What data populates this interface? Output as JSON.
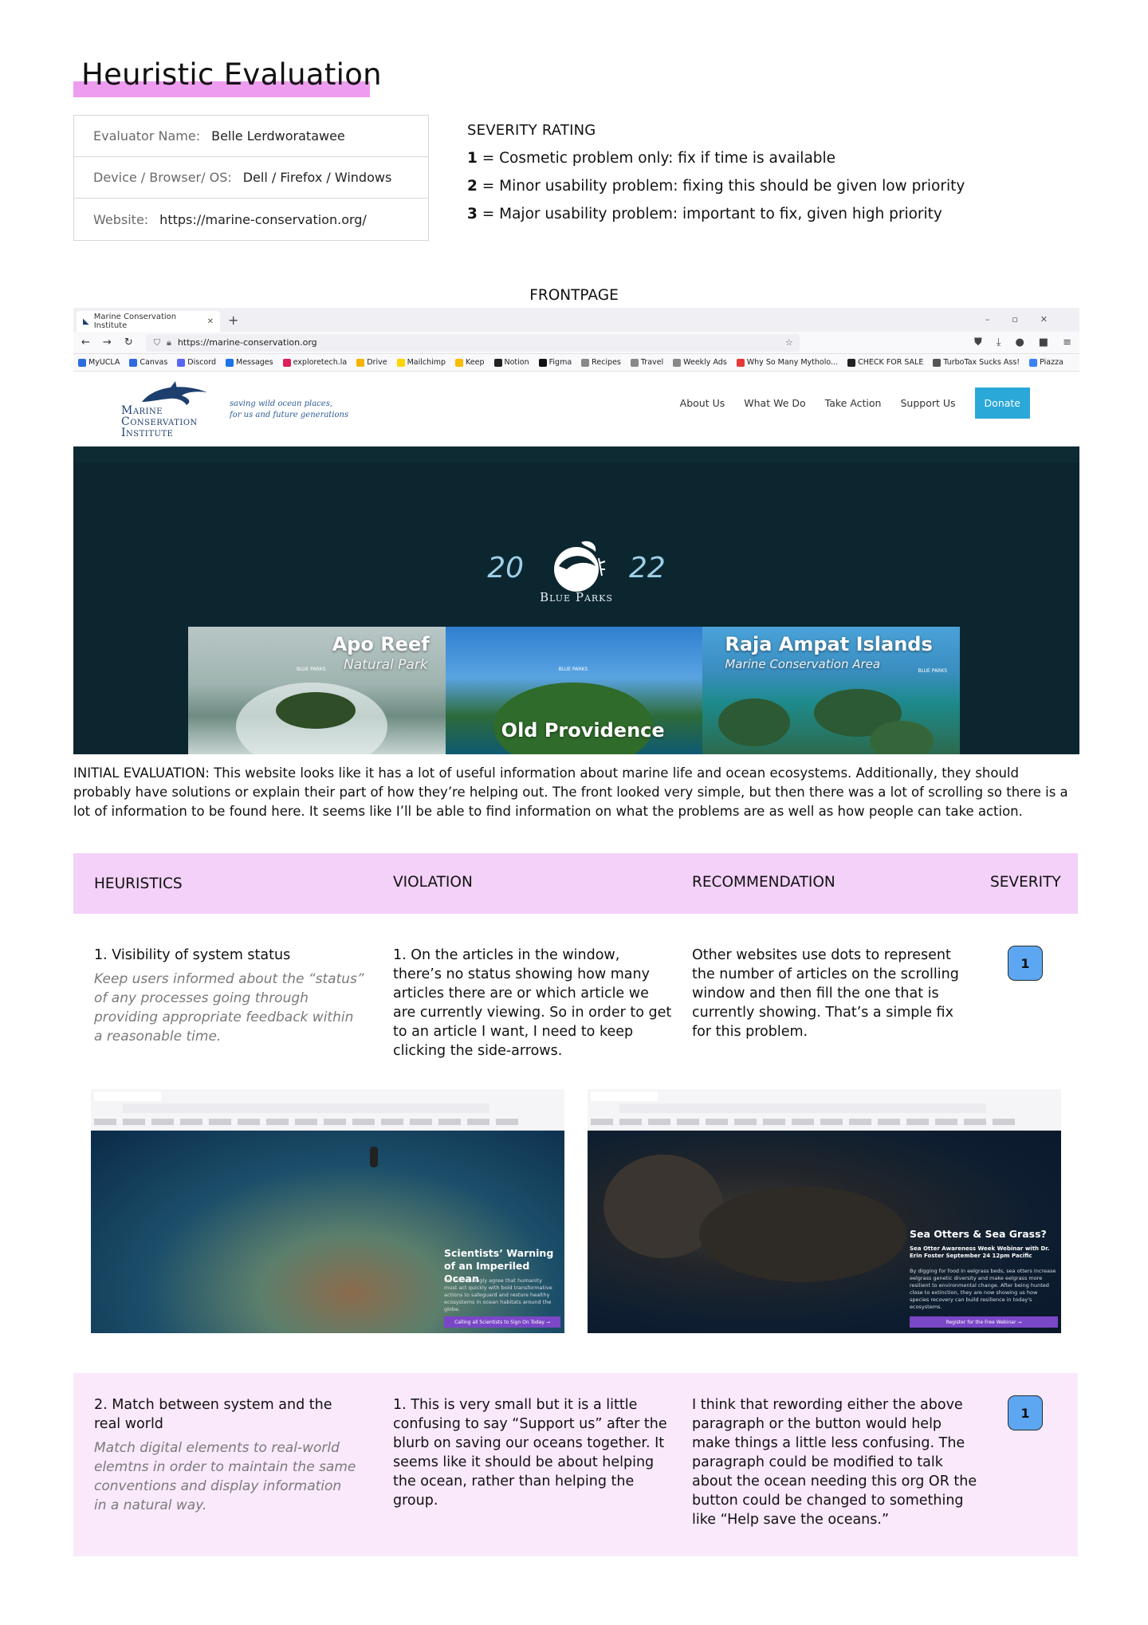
{
  "title": "Heuristic Evaluation",
  "info": {
    "evaluator_label": "Evaluator Name:",
    "evaluator_value": "Belle Lerdworatawee",
    "device_label": "Device / Browser/ OS:",
    "device_value": "Dell / Firefox / Windows",
    "website_label": "Website:",
    "website_value": "https://marine-conservation.org/"
  },
  "severity_legend": {
    "heading": "SEVERITY RATING",
    "items": [
      {
        "num": "1",
        "text": " = Cosmetic problem only: fix if time is available"
      },
      {
        "num": "2",
        "text": " = Minor usability problem: fixing this should be given low priority"
      },
      {
        "num": "3",
        "text": " = Major usability problem: important to fix, given high priority"
      }
    ]
  },
  "section_label": "FRONTPAGE",
  "browser": {
    "tab_title": "Marine Conservation Institute",
    "url": "https://marine-conservation.org",
    "bookmarks": [
      "MyUCLA",
      "Canvas",
      "Discord",
      "Messages",
      "exploretech.la",
      "Drive",
      "Mailchimp",
      "Keep",
      "Notion",
      "Figma",
      "Recipes",
      "Travel",
      "Weekly Ads",
      "Why So Many Mytholo...",
      "CHECK FOR SALE",
      "TurboTax Sucks Ass!",
      "Piazza"
    ],
    "bookmark_colors": [
      "#2d6cdf",
      "#2d6cdf",
      "#5865f2",
      "#1a73e8",
      "#e01e5a",
      "#f4b400",
      "#ffd400",
      "#fbbc04",
      "#222222",
      "#111111",
      "#888888",
      "#888888",
      "#888888",
      "#e53935",
      "#222222",
      "#555555",
      "#3b82f6"
    ],
    "site": {
      "logo_line1": "Marine",
      "logo_line2": "Conservation",
      "logo_line3": "Institute",
      "tagline_line1": "saving wild ocean places,",
      "tagline_line2": "for us and future generations",
      "nav": [
        "About Us",
        "What We Do",
        "Take Action",
        "Support Us"
      ],
      "donate": "Donate",
      "hero_year_left": "20",
      "hero_year_right": "22",
      "hero_brand": "Blue Parks",
      "parks": [
        {
          "name": "Apo Reef",
          "sub": "Natural Park"
        },
        {
          "name": "Old Providence",
          "sub": ""
        },
        {
          "name": "Raja Ampat Islands",
          "sub": "Marine Conservation Area"
        }
      ],
      "park_badge": "BLUE PARKS"
    }
  },
  "initial_evaluation": "INITIAL EVALUATION: This website looks like it has a lot of useful information about marine life and ocean ecosystems. Additionally, they should probably have solutions or explain their part of how they’re helping out. The front looked very simple, but then there was a lot of scrolling so there is a lot of information to be found here. It seems like I’ll be able to find information on what the problems are as well as how people can take action.",
  "table": {
    "headers": [
      "HEURISTICS",
      "VIOLATION",
      "RECOMMENDATION",
      "SEVERITY"
    ],
    "rows": [
      {
        "heuristic": "1. Visibility of system status",
        "heuristic_desc": "Keep users informed about the “status” of any processes going through providing appropriate feedback within a reasonable time.",
        "violation": "1. On the articles in the window, there’s no status showing how many articles there are or which article we are currently viewing. So in order to get to an article I want, I need to keep clicking the side-arrows.",
        "recommendation": "Other websites use dots to represent the number of articles on the scrolling window and then fill the one that is currently showing. That’s a simple fix for this problem.",
        "severity": "1"
      },
      {
        "heuristic": "2. Match between system and the real world",
        "heuristic_desc": "Match digital elements to real-world elemtns in order to maintain the same conventions and display information in a natural way.",
        "violation": "1. This is very small but it is a little confusing to say “Support us” after the blurb on saving our oceans together. It seems like it should be about helping the ocean, rather than helping the group.",
        "recommendation": "I think that rewording either the above paragraph or the button would help make things a little less confusing. The paragraph could be modified to talk about the ocean needing this org OR the button could be changed to something like “Help save the oceans.”",
        "severity": "1"
      }
    ]
  },
  "screenshots": [
    {
      "headline": "Scientists’ Warning of an Imperiled Ocean",
      "body": "We resoundingly agree that humanity must act quickly with bold transformative actions to safeguard and restore healthy ecosystems in ocean habitats around the globe.",
      "button": "Calling all Scientists to Sign On Today →"
    },
    {
      "headline": "Sea Otters & Sea Grass?",
      "subhead": "Sea Otter Awareness Week Webinar with Dr. Erin Foster September 24 12pm Pacific",
      "body": "By digging for food in eelgrass beds, sea otters increase eelgrass genetic diversity and make eelgrass more resilient to environmental change. After being hunted close to extinction, they are now showing us how species recovery can build resilience in today's ecosystems.",
      "button": "Register for the Free Webinar →"
    }
  ]
}
